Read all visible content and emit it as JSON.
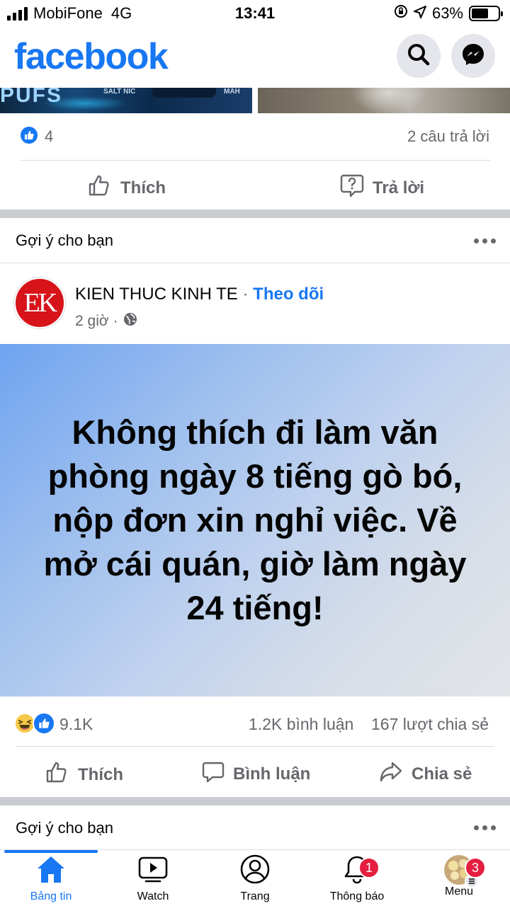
{
  "status_bar": {
    "carrier": "MobiFone",
    "network": "4G",
    "time": "13:41",
    "battery": "63%",
    "battery_level": 0.63
  },
  "header": {
    "logo": "facebook",
    "brand_color": "#1877f2"
  },
  "top_images": {
    "left_text_1": "SALT NIC",
    "left_text_2": "MAH"
  },
  "prev_post": {
    "like_count": "4",
    "reply_count": "2 câu trả lời",
    "like_label": "Thích",
    "reply_label": "Trả lời"
  },
  "suggest_1": {
    "title": "Gợi ý cho bạn"
  },
  "post": {
    "avatar_text": "EK",
    "author": "KIEN THUC KINH TE",
    "separator": "·",
    "follow_label": "Theo dõi",
    "time": "2 giờ",
    "meta_separator": "·",
    "body": "Không thích đi làm văn phòng ngày 8 tiếng gò bó, nộp đơn xin nghỉ việc. Về mở cái quán, giờ làm ngày 24 tiếng!",
    "reaction_count": "9.1K",
    "comment_count": "1.2K bình luận",
    "share_count": "167 lượt chia sẻ",
    "like_label": "Thích",
    "comment_label": "Bình luận",
    "share_label": "Chia sẻ"
  },
  "suggest_2": {
    "title": "Gợi ý cho bạn"
  },
  "tabbar": {
    "tabs": [
      {
        "label": "Bảng tin",
        "icon": "home-icon"
      },
      {
        "label": "Watch",
        "icon": "watch-icon"
      },
      {
        "label": "Trang",
        "icon": "pages-icon"
      },
      {
        "label": "Thông báo",
        "icon": "bell-icon",
        "badge": "1"
      },
      {
        "label": "Menu",
        "icon": "profile-menu-icon",
        "badge": "3"
      }
    ]
  }
}
